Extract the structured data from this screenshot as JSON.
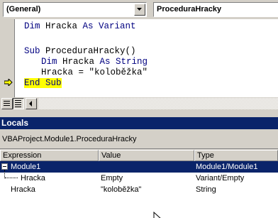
{
  "combos": {
    "object": "(General)",
    "procedure": "ProceduraHracky"
  },
  "code": {
    "line1_kw1": "Dim",
    "line1_mid": " Hracka ",
    "line1_kw2": "As Variant",
    "line2_kw": "Sub",
    "line2_rest": " ProceduraHracky()",
    "line3_kw1": "Dim",
    "line3_mid": " Hracka ",
    "line3_kw2": "As String",
    "line4": "Hracka = \"koloběžka\"",
    "line5": "End Sub",
    "current_line_color": "#ffff00",
    "execution_arrow_icon": "yellow-arrow-icon"
  },
  "locals": {
    "title": "Locals",
    "context": "VBAProject.Module1.ProceduraHracky",
    "columns": [
      "Expression",
      "Value",
      "Type"
    ],
    "rows": [
      {
        "expression": "Module1",
        "value": "",
        "type": "Module1/Module1",
        "selected": true
      },
      {
        "expression": "Hracka",
        "value": "Empty",
        "type": "Variant/Empty"
      },
      {
        "expression": "Hracka",
        "value": "\"koloběžka\"",
        "type": "String"
      }
    ]
  },
  "colors": {
    "titlebar": "#0a246a",
    "keyword": "#000080",
    "highlight": "#ffff00",
    "chrome": "#d4d0c8"
  }
}
